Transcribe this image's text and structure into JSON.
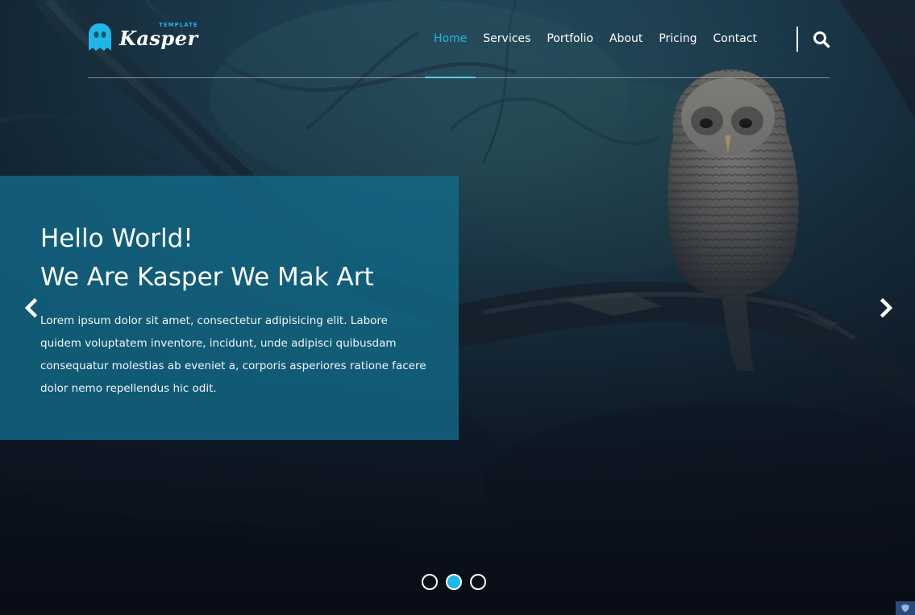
{
  "brand": {
    "name": "Kasper",
    "tagline": "TEMPLATE",
    "accent_color": "#21b6e8"
  },
  "nav": {
    "items": [
      {
        "label": "Home",
        "active": true
      },
      {
        "label": "Services",
        "active": false
      },
      {
        "label": "Portfolio",
        "active": false
      },
      {
        "label": "About",
        "active": false
      },
      {
        "label": "Pricing",
        "active": false
      },
      {
        "label": "Contact",
        "active": false
      }
    ],
    "search_icon": "search-icon"
  },
  "hero": {
    "title_line1": "Hello World!",
    "title_line2": "We Are Kasper We Mak Art",
    "description": "Lorem ipsum dolor sit amet, consectetur adipisicing elit. Labore quidem voluptatem inventore, incidunt, unde adipisci quibusdam consequatur molestias ab eveniet a, corporis asperiores ratione facere dolor nemo repellendus hic odit.",
    "box_color": "#126c8a"
  },
  "slider": {
    "prev_icon": "chevron-left-icon",
    "next_icon": "chevron-right-icon",
    "slide_count": 3,
    "active_slide": 2
  }
}
